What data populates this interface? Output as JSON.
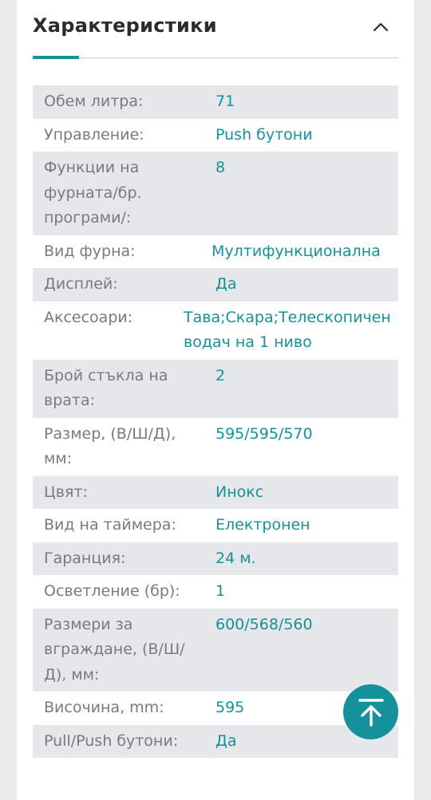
{
  "section": {
    "title": "Характеристики"
  },
  "specs": [
    {
      "label": "Обем литра:",
      "value": "71"
    },
    {
      "label": "Управление:",
      "value": "Push бутони"
    },
    {
      "label": "Функции на фурната/бр. програми/:",
      "value": "8"
    },
    {
      "label": "Вид фурна:",
      "value": "Мултифункционална"
    },
    {
      "label": "Дисплей:",
      "value": "Да"
    },
    {
      "label": "Аксесоари:",
      "value": "Тава;Скара;Телескопичен водач на 1 ниво"
    },
    {
      "label": "Брой стъкла на врата:",
      "value": "2"
    },
    {
      "label": "Размер, (В/Ш/Д), мм:",
      "value": "595/595/570"
    },
    {
      "label": "Цвят:",
      "value": "Инокс"
    },
    {
      "label": "Вид на таймера:",
      "value": "Електронен"
    },
    {
      "label": "Гаранция:",
      "value": "24 м."
    },
    {
      "label": "Осветление (бр):",
      "value": "1"
    },
    {
      "label": "Размери за вграждане, (В/Ш/Д), мм:",
      "value": "600/568/560"
    },
    {
      "label": "Височина, mm:",
      "value": "595"
    },
    {
      "label": "Pull/Push бутони:",
      "value": "Да"
    }
  ],
  "icons": {
    "collapse": "chevron-up-icon",
    "scroll_top": "arrow-up-to-top-icon"
  },
  "colors": {
    "accent": "#14919b",
    "label": "#7a7a7a",
    "row_shade": "#e5e7ea",
    "title": "#2b2b2b"
  }
}
